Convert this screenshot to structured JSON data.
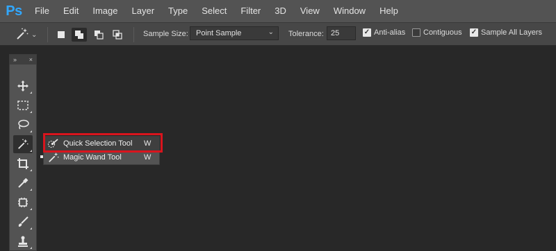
{
  "app": {
    "logo": "Ps"
  },
  "menu": [
    "File",
    "Edit",
    "Image",
    "Layer",
    "Type",
    "Select",
    "Filter",
    "3D",
    "View",
    "Window",
    "Help"
  ],
  "options": {
    "sample_size_label": "Sample Size:",
    "sample_size_value": "Point Sample",
    "tolerance_label": "Tolerance:",
    "tolerance_value": "25",
    "anti_alias": {
      "label": "Anti-alias",
      "checked": true
    },
    "contiguous": {
      "label": "Contiguous",
      "checked": false
    },
    "sample_all_layers": {
      "label": "Sample All Layers",
      "checked": true
    }
  },
  "toolbar": {
    "collapse_glyph": "»",
    "close_glyph": "×",
    "tools": [
      {
        "name": "move-tool",
        "icon": "move-icon"
      },
      {
        "name": "marquee-tool",
        "icon": "rectangular-marquee-icon"
      },
      {
        "name": "lasso-tool",
        "icon": "lasso-icon"
      },
      {
        "name": "magic-wand-tool",
        "icon": "magic-wand-icon",
        "active": true
      },
      {
        "name": "crop-tool",
        "icon": "crop-icon"
      },
      {
        "name": "eyedropper-tool",
        "icon": "eyedropper-icon"
      },
      {
        "name": "healing-brush-tool",
        "icon": "healing-brush-icon"
      },
      {
        "name": "brush-tool",
        "icon": "brush-icon"
      },
      {
        "name": "stamp-tool",
        "icon": "clone-stamp-icon"
      }
    ]
  },
  "flyout": [
    {
      "label": "Quick Selection Tool",
      "shortcut": "W",
      "icon": "quick-selection-icon"
    },
    {
      "label": "Magic Wand Tool",
      "shortcut": "W",
      "icon": "magic-wand-icon"
    }
  ],
  "colors": {
    "highlight": "#d9141d",
    "accent": "#31a8ff"
  }
}
